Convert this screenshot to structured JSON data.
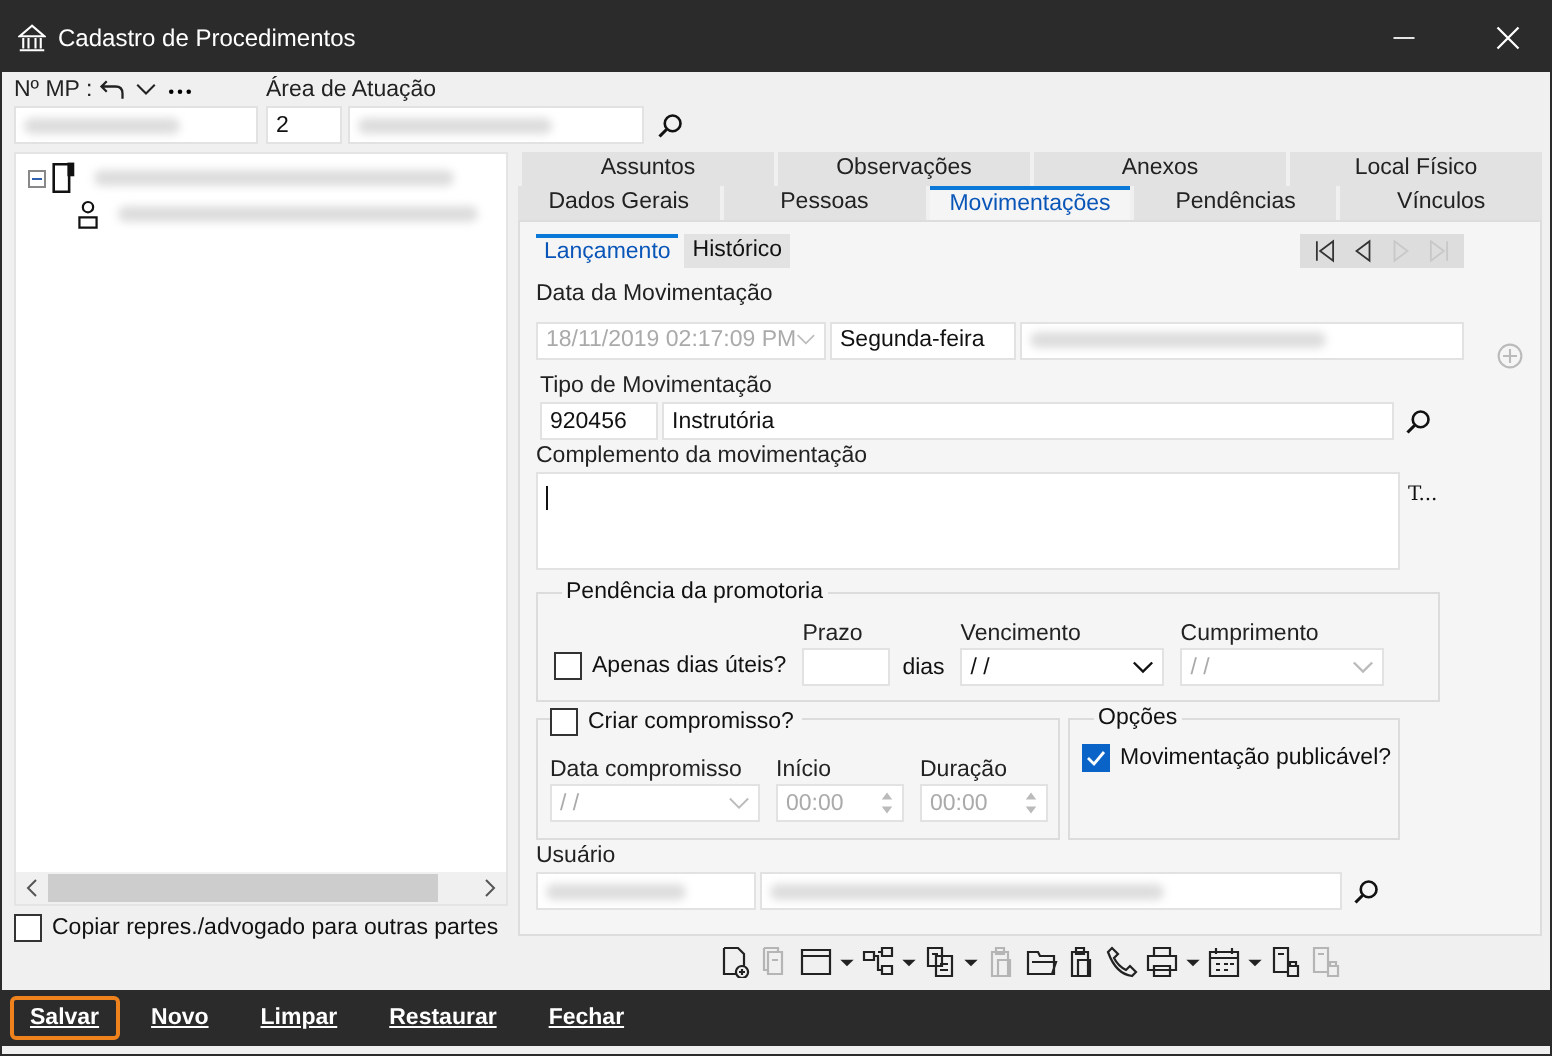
{
  "window": {
    "title": "Cadastro de Procedimentos"
  },
  "header": {
    "mp_label": "Nº MP :",
    "area_label": "Área de Atuação",
    "area_code": "2"
  },
  "tree": {
    "expanded": true
  },
  "copy_checkbox": {
    "label": "Copiar repres./advogado para outras partes",
    "checked": false
  },
  "tabs_row1": [
    {
      "label": "Assuntos",
      "selected": false
    },
    {
      "label": "Observações",
      "selected": false
    },
    {
      "label": "Anexos",
      "selected": false
    },
    {
      "label": "Local Físico",
      "selected": false
    }
  ],
  "tabs_row2": [
    {
      "label": "Dados Gerais",
      "selected": false
    },
    {
      "label": "Pessoas",
      "selected": false
    },
    {
      "label": "Movimentações",
      "selected": true
    },
    {
      "label": "Pendências",
      "selected": false
    },
    {
      "label": "Vínculos",
      "selected": false
    }
  ],
  "subtabs": [
    {
      "label": "Lançamento",
      "selected": true
    },
    {
      "label": "Histórico",
      "selected": false
    }
  ],
  "nav_buttons": [
    {
      "kind": "first",
      "disabled": false
    },
    {
      "kind": "prev",
      "disabled": false
    },
    {
      "kind": "next",
      "disabled": true
    },
    {
      "kind": "last",
      "disabled": true
    }
  ],
  "data_movimentacao": {
    "label": "Data da Movimentação",
    "value": "18/11/2019 02:17:09 PM",
    "disabled": true,
    "weekday": "Segunda-feira"
  },
  "tipo": {
    "label": "Tipo de Movimentação",
    "code": "920456",
    "name": "Instrutória"
  },
  "complemento": {
    "label": "Complemento da movimentação",
    "side_button": "T..."
  },
  "pendencia": {
    "title": "Pendência da promotoria",
    "dias_uteis": {
      "label": "Apenas dias úteis?",
      "checked": false
    },
    "prazo_label": "Prazo",
    "dias_label": "dias",
    "vencimento": {
      "label": "Vencimento",
      "value": "/ /",
      "disabled": false
    },
    "cumprimento": {
      "label": "Cumprimento",
      "value": "/ /",
      "disabled": true
    }
  },
  "compromisso": {
    "label": "Criar compromisso?",
    "checked": false,
    "data": {
      "label": "Data compromisso",
      "value": "/ /"
    },
    "inicio": {
      "label": "Início",
      "value": "00:00"
    },
    "duracao": {
      "label": "Duração",
      "value": "00:00"
    }
  },
  "opcoes": {
    "title": "Opções",
    "publicavel": {
      "label": "Movimentação publicável?",
      "checked": true
    }
  },
  "usuario": {
    "label": "Usuário"
  },
  "toolbar": [
    {
      "kind": "doc-add",
      "disabled": false,
      "dropdown": false
    },
    {
      "kind": "doc-copy",
      "disabled": true,
      "dropdown": false
    },
    {
      "kind": "window",
      "disabled": false,
      "dropdown": true
    },
    {
      "kind": "hierarchy",
      "disabled": false,
      "dropdown": true
    },
    {
      "kind": "transfer",
      "disabled": false,
      "dropdown": true
    },
    {
      "kind": "clipboard",
      "disabled": true,
      "dropdown": false
    },
    {
      "kind": "folder",
      "disabled": false,
      "dropdown": false
    },
    {
      "kind": "clipboard",
      "disabled": false,
      "dropdown": false
    },
    {
      "kind": "phone",
      "disabled": false,
      "dropdown": false
    },
    {
      "kind": "printer",
      "disabled": false,
      "dropdown": true
    },
    {
      "kind": "calendar",
      "disabled": false,
      "dropdown": true
    },
    {
      "kind": "doc-lock",
      "disabled": false,
      "dropdown": false
    },
    {
      "kind": "doc-lock",
      "disabled": true,
      "dropdown": false
    }
  ],
  "actions": [
    {
      "label": "Salvar",
      "focused": true
    },
    {
      "label": "Novo",
      "focused": false
    },
    {
      "label": "Limpar",
      "focused": false
    },
    {
      "label": "Restaurar",
      "focused": false
    },
    {
      "label": "Fechar",
      "focused": false
    }
  ]
}
